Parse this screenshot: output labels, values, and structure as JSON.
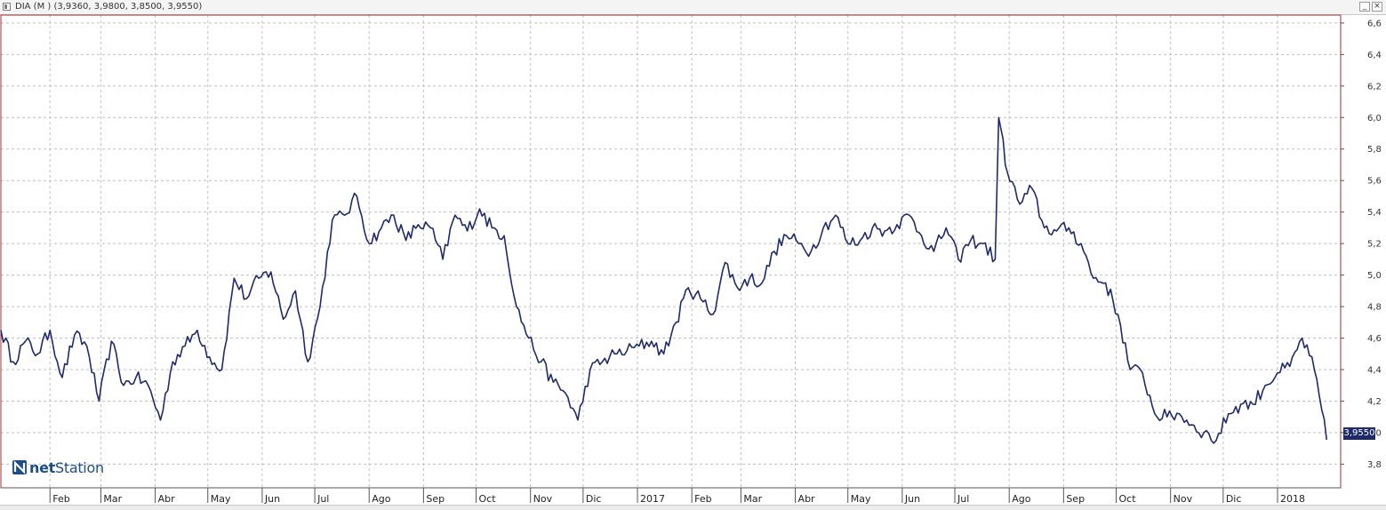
{
  "window": {
    "title": "DIA (M ) (3,9360, 3,9800, 3,8500, 3,9550)",
    "minimize_label": "_",
    "close_label": "×"
  },
  "logo": {
    "text_bold": "net",
    "text_regular": "Station"
  },
  "colors": {
    "line": "#1f2a6b",
    "frame": "#a03030",
    "grid": "#c0c0c0",
    "last_label_bg": "#1f2a6b"
  },
  "chart_data": {
    "type": "line",
    "series": [
      {
        "x": [
          "2016-01-04",
          "2016-01-11",
          "2016-01-18",
          "2016-01-25",
          "2016-02-01",
          "2016-02-08",
          "2016-02-15",
          "2016-02-22",
          "2016-02-29",
          "2016-03-07",
          "2016-03-14",
          "2016-03-21",
          "2016-03-28",
          "2016-04-04",
          "2016-04-11",
          "2016-04-18",
          "2016-04-25",
          "2016-05-02",
          "2016-05-09",
          "2016-05-16",
          "2016-05-23",
          "2016-05-30",
          "2016-06-06",
          "2016-06-13",
          "2016-06-20",
          "2016-06-27",
          "2016-07-04",
          "2016-07-11",
          "2016-07-18",
          "2016-07-25",
          "2016-08-01",
          "2016-08-08",
          "2016-08-15",
          "2016-08-22",
          "2016-08-29",
          "2016-09-05",
          "2016-09-12",
          "2016-09-19",
          "2016-09-26",
          "2016-10-03",
          "2016-10-10",
          "2016-10-17",
          "2016-10-24",
          "2016-10-31",
          "2016-11-07",
          "2016-11-14",
          "2016-11-21",
          "2016-11-28",
          "2016-12-05",
          "2016-12-12",
          "2016-12-19",
          "2016-12-26",
          "2017-01-02",
          "2017-01-09",
          "2017-01-16",
          "2017-01-23",
          "2017-01-30",
          "2017-02-06",
          "2017-02-13",
          "2017-02-20",
          "2017-02-27",
          "2017-03-06",
          "2017-03-13",
          "2017-03-20",
          "2017-03-27",
          "2017-04-03",
          "2017-04-10",
          "2017-04-17",
          "2017-04-24",
          "2017-05-01",
          "2017-05-08",
          "2017-05-15",
          "2017-05-22",
          "2017-05-29",
          "2017-06-05",
          "2017-06-12",
          "2017-06-19",
          "2017-06-26",
          "2017-07-03",
          "2017-07-10",
          "2017-07-17",
          "2017-07-24",
          "2017-07-26",
          "2017-07-31",
          "2017-08-07",
          "2017-08-14",
          "2017-08-21",
          "2017-08-28",
          "2017-09-04",
          "2017-09-11",
          "2017-09-18",
          "2017-09-25",
          "2017-10-02",
          "2017-10-09",
          "2017-10-16",
          "2017-10-23",
          "2017-10-30",
          "2017-11-06",
          "2017-11-13",
          "2017-11-20",
          "2017-11-27",
          "2017-12-04",
          "2017-12-11",
          "2017-12-18",
          "2017-12-25",
          "2018-01-01",
          "2018-01-08",
          "2018-01-15",
          "2018-01-22",
          "2018-01-29"
        ],
        "y": [
          4.65,
          4.45,
          4.58,
          4.5,
          4.65,
          4.35,
          4.62,
          4.55,
          4.2,
          4.58,
          4.3,
          4.35,
          4.3,
          4.08,
          4.45,
          4.55,
          4.65,
          4.48,
          4.4,
          4.98,
          4.85,
          4.98,
          5.02,
          4.72,
          4.9,
          4.45,
          4.8,
          5.35,
          5.38,
          5.5,
          5.2,
          5.3,
          5.38,
          5.22,
          5.32,
          5.3,
          5.1,
          5.38,
          5.28,
          5.42,
          5.3,
          5.25,
          4.8,
          4.6,
          4.45,
          4.32,
          4.25,
          4.08,
          4.4,
          4.45,
          4.5,
          4.52,
          4.55,
          4.58,
          4.5,
          4.7,
          4.92,
          4.85,
          4.75,
          5.08,
          4.92,
          4.98,
          4.95,
          5.15,
          5.25,
          5.2,
          5.15,
          5.3,
          5.38,
          5.2,
          5.22,
          5.3,
          5.28,
          5.32,
          5.38,
          5.25,
          5.15,
          5.3,
          5.1,
          5.22,
          5.2,
          5.1,
          6.0,
          5.65,
          5.45,
          5.55,
          5.3,
          5.28,
          5.3,
          5.2,
          4.98,
          4.95,
          4.75,
          4.4,
          4.38,
          4.12,
          4.1,
          4.12,
          4.05,
          4.0,
          3.95,
          4.12,
          4.18,
          4.18,
          4.3,
          4.38,
          4.42,
          4.6,
          4.4,
          3.955
        ]
      }
    ],
    "title": "DIA (M ) (3,9360, 3,9800, 3,8500, 3,9550)",
    "xlabel": "",
    "ylabel": "",
    "ylim": [
      3.65,
      6.65
    ],
    "y_ticks": [
      "3,8",
      "4,0",
      "4,2",
      "4,4",
      "4,6",
      "4,8",
      "5,0",
      "5,2",
      "5,4",
      "5,6",
      "5,8",
      "6,0",
      "6,2",
      "6,4",
      "6,6"
    ],
    "y_tick_values": [
      3.8,
      4.0,
      4.2,
      4.4,
      4.6,
      4.8,
      5.0,
      5.2,
      5.4,
      5.6,
      5.8,
      6.0,
      6.2,
      6.4,
      6.6
    ],
    "x_ticks": [
      "Feb",
      "Mar",
      "Abr",
      "May",
      "Jun",
      "Jul",
      "Ago",
      "Sep",
      "Oct",
      "Nov",
      "Dic",
      "2017",
      "Feb",
      "Mar",
      "Abr",
      "May",
      "Jun",
      "Jul",
      "Ago",
      "Sep",
      "Oct",
      "Nov",
      "Dic",
      "2018"
    ],
    "x_tick_dates": [
      "2016-02-01",
      "2016-03-01",
      "2016-04-01",
      "2016-05-01",
      "2016-06-01",
      "2016-07-01",
      "2016-08-01",
      "2016-09-01",
      "2016-10-01",
      "2016-11-01",
      "2016-12-01",
      "2017-01-01",
      "2017-02-01",
      "2017-03-01",
      "2017-04-01",
      "2017-05-01",
      "2017-06-01",
      "2017-07-01",
      "2017-08-01",
      "2017-09-01",
      "2017-10-01",
      "2017-11-01",
      "2017-12-01",
      "2018-01-01"
    ],
    "x_range": [
      "2016-01-04",
      "2018-02-06"
    ],
    "grid": true,
    "last_value_label": "3,9550"
  }
}
